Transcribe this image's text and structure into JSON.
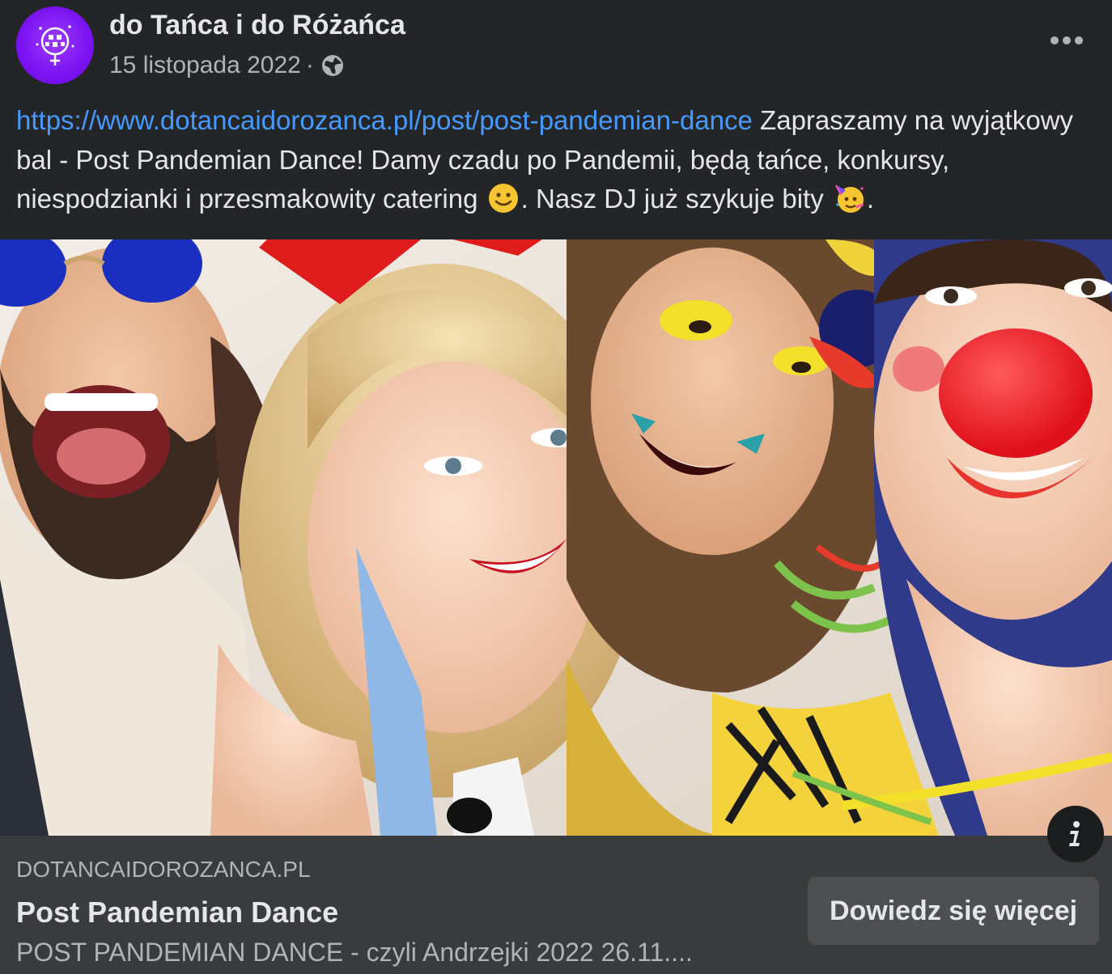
{
  "post": {
    "page_name": "do Tańca i do Różańca",
    "date": "15 listopada 2022",
    "separator": "·",
    "audience_icon": "globe-icon",
    "more_icon": "more-options-icon",
    "text": {
      "link": "https://www.dotancaidorozanca.pl/post/post-pandemian-dance",
      "part1": " Zapraszamy na wyjątkowy bal - Post Pandemian Dance! Damy czadu po Pandemii, będą tańce, konkursy, niespodzianki i przesmakowity catering ",
      "emoji1": "slightly-smiling-face-emoji",
      "part2": ". Nasz DJ już szykuje bity ",
      "emoji2": "partying-face-emoji",
      "part3": "."
    }
  },
  "image": {
    "description_icon": "info-icon"
  },
  "link_preview": {
    "domain": "DOTANCAIDOROZANCA.PL",
    "title": "Post Pandemian Dance",
    "description": "POST PANDEMIAN DANCE - czyli Andrzejki 2022 26.11....",
    "button_label": "Dowiedz się więcej"
  },
  "colors": {
    "background": "#242526",
    "preview_background": "#3a3b3c",
    "link": "#4599ff",
    "avatar": "#7a12f2",
    "button": "#4e4f50"
  }
}
